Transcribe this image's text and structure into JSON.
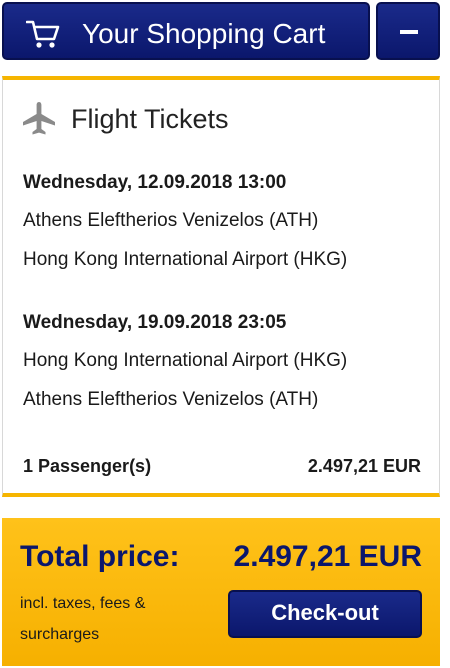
{
  "colors": {
    "primary": "#0b176c",
    "accent": "#f6b500",
    "text": "#1a1a1a"
  },
  "header": {
    "title": "Your Shopping Cart",
    "icon": "cart-icon",
    "collapse_icon": "minus-icon"
  },
  "flights": {
    "section_title": "Flight Tickets",
    "icon": "airplane-icon",
    "legs": [
      {
        "datetime": "Wednesday, 12.09.2018 13:00",
        "from": "Athens Eleftherios Venizelos (ATH)",
        "to": "Hong Kong International Airport (HKG)"
      },
      {
        "datetime": "Wednesday, 19.09.2018 23:05",
        "from": "Hong Kong International Airport (HKG)",
        "to": "Athens Eleftherios Venizelos (ATH)"
      }
    ],
    "passengers": "1 Passenger(s)",
    "price": "2.497,21 EUR"
  },
  "total": {
    "label": "Total price:",
    "value": "2.497,21 EUR",
    "note": "incl. taxes, fees & surcharges",
    "checkout_label": "Check-out"
  }
}
